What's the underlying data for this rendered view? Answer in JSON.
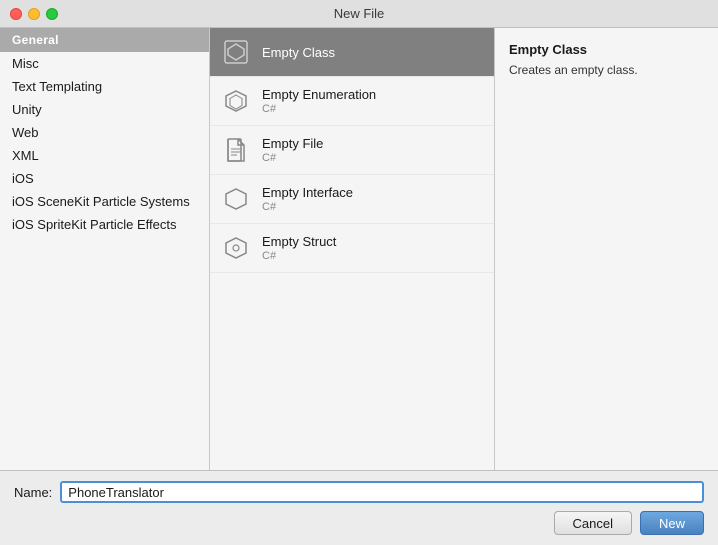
{
  "titleBar": {
    "title": "New File"
  },
  "leftPanel": {
    "header": "General",
    "items": [
      {
        "id": "misc",
        "label": "Misc"
      },
      {
        "id": "text-templating",
        "label": "Text Templating"
      },
      {
        "id": "unity",
        "label": "Unity",
        "selected": false
      },
      {
        "id": "web",
        "label": "Web"
      },
      {
        "id": "xml",
        "label": "XML"
      },
      {
        "id": "ios",
        "label": "iOS"
      },
      {
        "id": "ios-scenekit",
        "label": "iOS SceneKit Particle Systems"
      },
      {
        "id": "ios-spritekit",
        "label": "iOS SpriteKit Particle Effects"
      }
    ]
  },
  "middlePanel": {
    "items": [
      {
        "id": "empty-class",
        "label": "Empty Class",
        "subtitle": "",
        "selected": true
      },
      {
        "id": "empty-enumeration",
        "label": "Empty Enumeration",
        "subtitle": "C#"
      },
      {
        "id": "empty-file",
        "label": "Empty File",
        "subtitle": "C#"
      },
      {
        "id": "empty-interface",
        "label": "Empty Interface",
        "subtitle": "C#"
      },
      {
        "id": "empty-struct",
        "label": "Empty Struct",
        "subtitle": "C#"
      }
    ]
  },
  "rightPanel": {
    "title": "Empty Class",
    "description": "Creates an empty class."
  },
  "bottomBar": {
    "nameLabel": "Name:",
    "nameValue": "PhoneTranslator",
    "cancelLabel": "Cancel",
    "newLabel": "New"
  }
}
